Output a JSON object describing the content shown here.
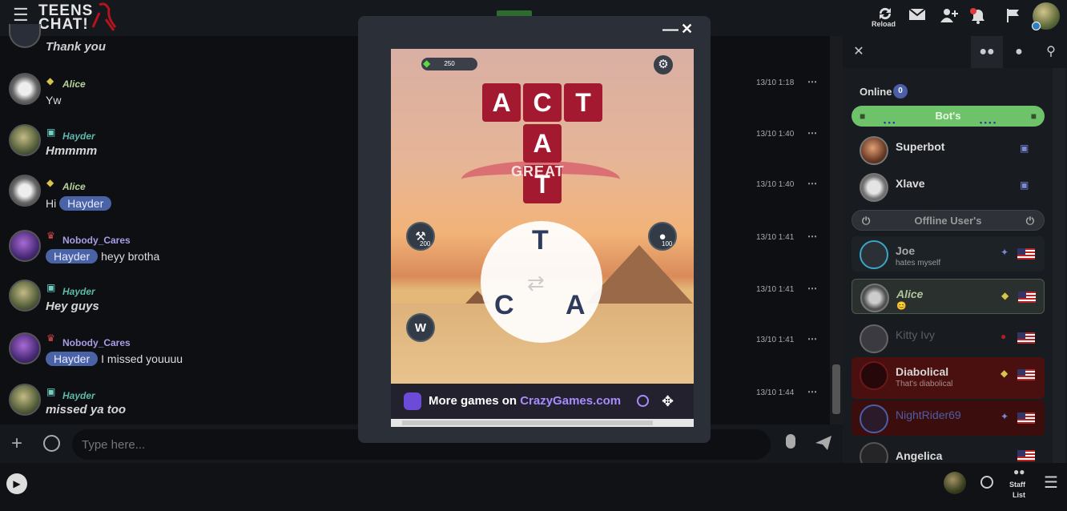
{
  "topbar": {
    "logo_line1": "TEENS",
    "logo_line2": "CHAT!",
    "reload_label": "Reload",
    "icons": [
      "menu-icon",
      "reload-icon",
      "mail-icon",
      "add-friend-icon",
      "notification-bell-icon",
      "report-flag-icon",
      "user-avatar"
    ]
  },
  "chat": {
    "first_text": "Thank you",
    "messages": [
      {
        "user": "Alice",
        "rank_icon": "gem",
        "text": "Yw",
        "mention": "",
        "time": "13/10 1:18",
        "name_color": "#b8d29b",
        "italic": false
      },
      {
        "user": "Hayder",
        "rank_icon": "terminal",
        "text": "Hmmmm",
        "mention": "",
        "time": "13/10 1:40",
        "name_color": "#5fb8aa",
        "italic": true
      },
      {
        "user": "Alice",
        "rank_icon": "gem",
        "text": "Hi",
        "mention": "Hayder",
        "mention_after": true,
        "time": "13/10 1:40",
        "name_color": "#b8d29b",
        "italic": false
      },
      {
        "user": "Nobody_Cares",
        "rank_icon": "crown",
        "text": "heyy brotha",
        "mention": "Hayder",
        "time": "13/10 1:41",
        "name_color": "#a59fe6",
        "italic": false
      },
      {
        "user": "Hayder",
        "rank_icon": "terminal",
        "text": "Hey guys",
        "mention": "",
        "time": "13/10 1:41",
        "name_color": "#5fb8aa",
        "italic": true
      },
      {
        "user": "Nobody_Cares",
        "rank_icon": "crown",
        "text": "I missed youuuu",
        "mention": "Hayder",
        "time": "13/10 1:41",
        "name_color": "#a59fe6",
        "italic": false
      },
      {
        "user": "Hayder",
        "rank_icon": "terminal",
        "text": "missed ya too",
        "mention": "",
        "time": "13/10 1:44",
        "name_color": "#5fb8aa",
        "italic": true
      }
    ],
    "input_placeholder": "Type here..."
  },
  "right_panel": {
    "online_label": "Online",
    "online_count": "0",
    "bots_label": "Bot's",
    "offline_label": "Offline User's",
    "online_users": [
      {
        "name": "Superbot"
      },
      {
        "name": "Xlave"
      }
    ],
    "offline_users": [
      {
        "name": "Joe",
        "mood": "hates myself"
      },
      {
        "name": "Alice",
        "mood": "😊"
      },
      {
        "name": "Kitty Ivy",
        "mood": ""
      },
      {
        "name": "Diabolical",
        "mood": "That's diabolical"
      },
      {
        "name": "NightRider69",
        "mood": ""
      },
      {
        "name": "Angelica",
        "mood": ""
      }
    ]
  },
  "bottombar": {
    "staff_label_1": "Staff",
    "staff_label_2": "List"
  },
  "game_modal": {
    "score": "250",
    "tiles": [
      "A",
      "C",
      "T",
      "A",
      "T"
    ],
    "feedback": "GREAT",
    "wheel_letters": [
      "T",
      "C",
      "A"
    ],
    "hammer_cost": "200",
    "hint_cost": "100",
    "promo_text": "More games on ",
    "promo_brand": "CrazyGames.com"
  }
}
